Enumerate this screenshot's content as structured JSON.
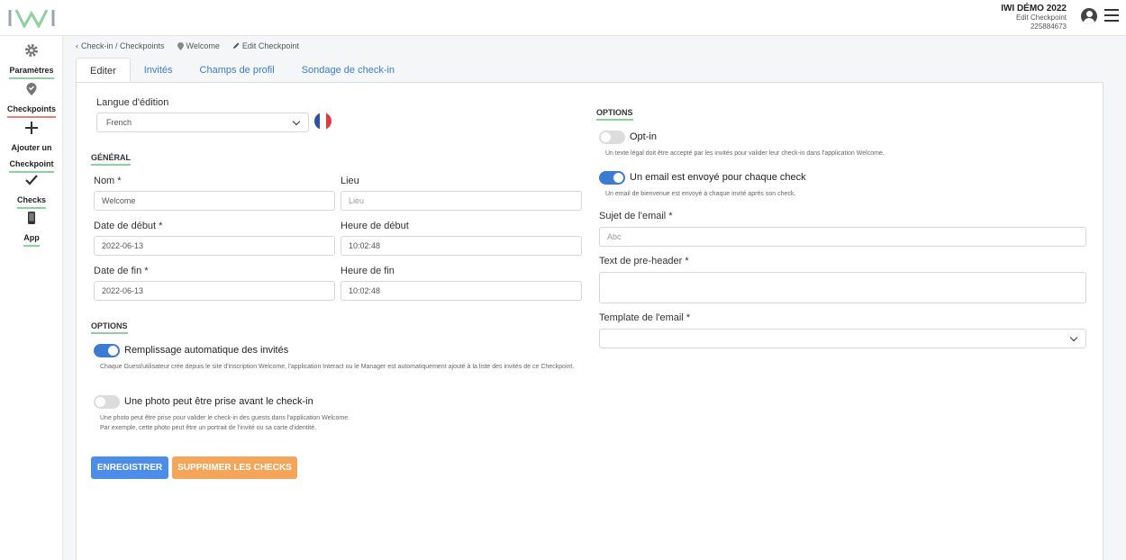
{
  "header": {
    "brand_name": "IWI DÉMO 2022",
    "page_name": "Edit Checkpoint",
    "id": "225884673"
  },
  "sidebar": {
    "items": [
      {
        "label": "Paramètres",
        "icon": "gear-icon"
      },
      {
        "label": "Checkpoints",
        "icon": "map-pin-check-icon"
      },
      {
        "label_line1": "Ajouter un",
        "label_line2": "Checkpoint",
        "icon": "plus-icon"
      },
      {
        "label": "Checks",
        "icon": "checkmark-icon"
      },
      {
        "label": "App",
        "icon": "phone-icon"
      }
    ]
  },
  "breadcrumb": {
    "items": [
      "Check-in / Checkpoints",
      "Welcome",
      "Edit Checkpoint"
    ]
  },
  "tabs": [
    "Editer",
    "Invités",
    "Champs de profil",
    "Sondage de check-in"
  ],
  "form": {
    "language_label": "Langue d'édition",
    "language_value": "French",
    "general_title": "GÉNÉRAL",
    "name_label": "Nom *",
    "name_value": "Welcome",
    "place_label": "Lieu",
    "place_placeholder": "Lieu",
    "start_date_label": "Date de début *",
    "start_date_value": "2022-06-13",
    "start_time_label": "Heure de début",
    "start_time_value": "10:02:48",
    "end_date_label": "Date de fin *",
    "end_date_value": "2022-06-13",
    "end_time_label": "Heure de fin",
    "end_time_value": "10:02:48",
    "options_title": "OPTIONS",
    "autofill_label": "Remplissage automatique des invités",
    "autofill_on": true,
    "autofill_hint": "Chaque Guest/utilisateur crée depuis le site d'inscription Welcome, l'application Interact ou le Manager est automatiquement ajouté à la liste des invités de ce Checkpoint.",
    "photo_label": "Une photo peut être prise avant le check-in",
    "photo_on": false,
    "photo_hint_1": "Une photo peut être prise pour valider le check-in des guests dans l'application Welcome.",
    "photo_hint_2": "Par exemple, cette photo peut être un portrait de l'invité ou sa carte d'identité.",
    "save_button": "ENREGISTRER",
    "delete_button": "SUPPRIMER LES CHECKS"
  },
  "right": {
    "options_title": "OPTIONS",
    "optin_label": "Opt-in",
    "optin_on": false,
    "optin_hint": "Un texte légal doit être accepté par les invités pour valider leur check-in dans l'application Welcome.",
    "email_label": "Un email est envoyé pour chaque check",
    "email_on": true,
    "email_hint": "Un email de bienvenue est envoyé à chaque invité après son check.",
    "subject_label": "Sujet de l'email *",
    "subject_placeholder": "Abc",
    "preheader_label": "Text de pre-header *",
    "template_label": "Template de l'email *"
  },
  "colors": {
    "accent": "#3b7bd4",
    "primary_button": "#4b8de8",
    "warning_button": "#f5a55a",
    "section_underline": "#8fd19e"
  }
}
